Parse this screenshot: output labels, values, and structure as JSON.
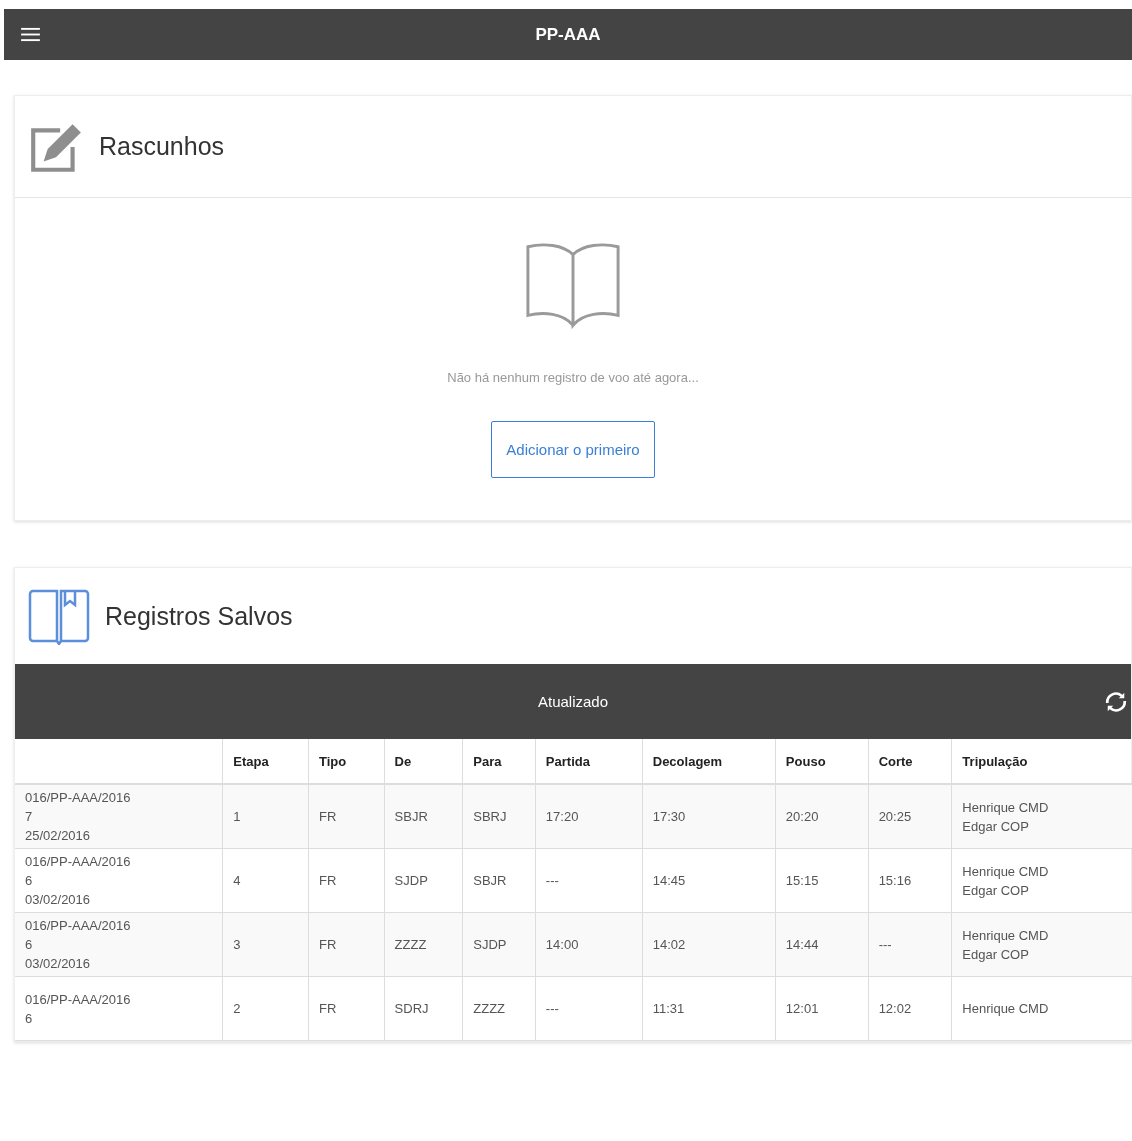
{
  "top_bar": {
    "title": "PP-AAA"
  },
  "drafts": {
    "title": "Rascunhos",
    "empty_message": "Não há nenhum registro de voo até agora...",
    "add_button": "Adicionar o primeiro"
  },
  "saved": {
    "title": "Registros Salvos",
    "status": "Atualizado",
    "columns": [
      "",
      "Etapa",
      "Tipo",
      "De",
      "Para",
      "Partida",
      "Decolagem",
      "Pouso",
      "Corte",
      "Tripulação"
    ],
    "rows": [
      {
        "cells": [
          "016/PP-AAA/2016\n7\n25/02/2016",
          "1",
          "FR",
          "SBJR",
          "SBRJ",
          "17:20",
          "17:30",
          "20:20",
          "20:25",
          "Henrique CMD\nEdgar COP"
        ]
      },
      {
        "cells": [
          "016/PP-AAA/2016\n6\n03/02/2016",
          "4",
          "FR",
          "SJDP",
          "SBJR",
          "---",
          "14:45",
          "15:15",
          "15:16",
          "Henrique CMD\nEdgar COP"
        ]
      },
      {
        "cells": [
          "016/PP-AAA/2016\n6\n03/02/2016",
          "3",
          "FR",
          "ZZZZ",
          "SJDP",
          "14:00",
          "14:02",
          "14:44",
          "---",
          "Henrique CMD\nEdgar COP"
        ]
      },
      {
        "cells": [
          "016/PP-AAA/2016\n6",
          "2",
          "FR",
          "SDRJ",
          "ZZZZ",
          "---",
          "11:31",
          "12:01",
          "12:02",
          "Henrique CMD"
        ]
      }
    ]
  }
}
